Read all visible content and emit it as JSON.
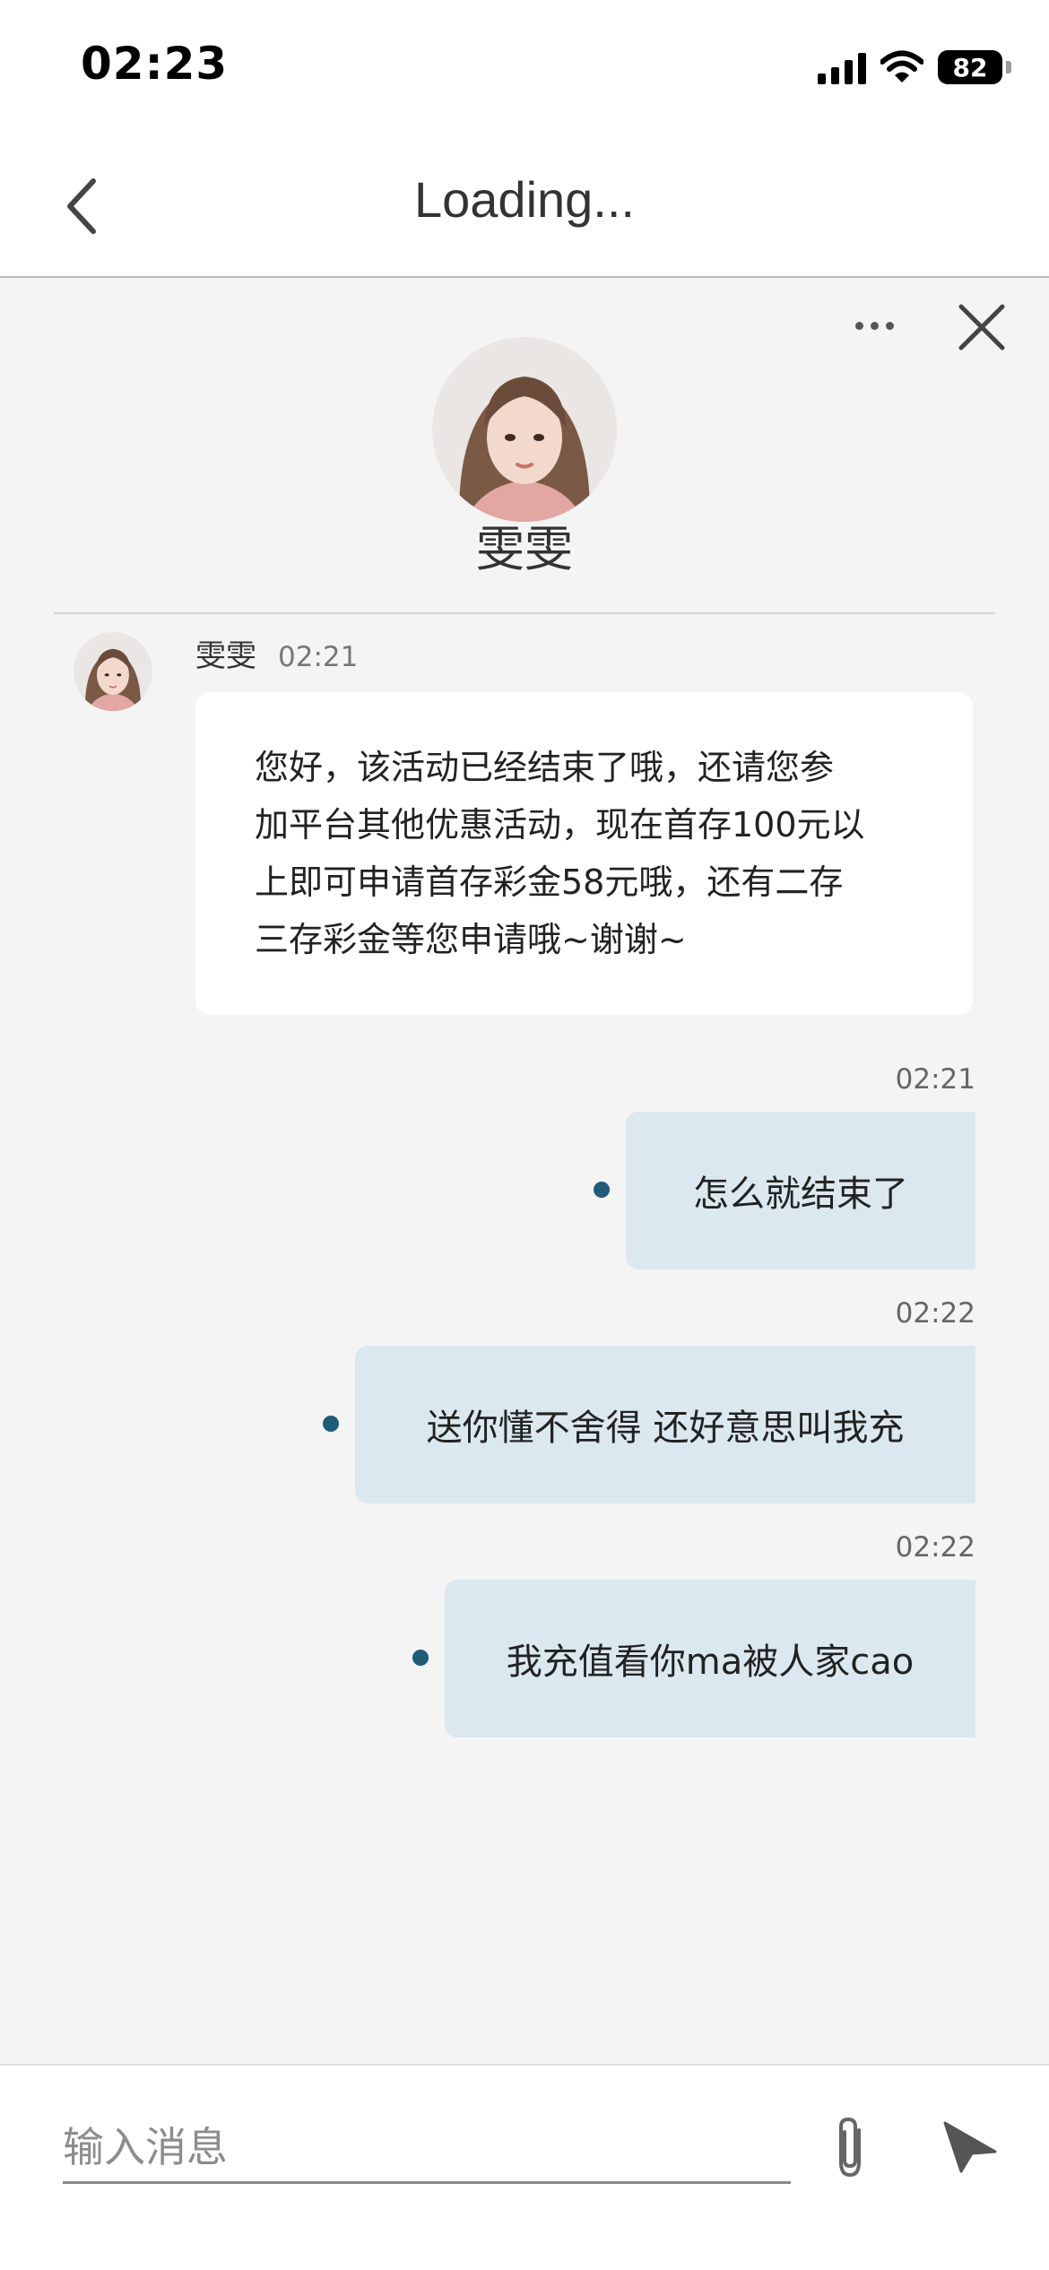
{
  "status_bar": {
    "time": "02:23",
    "battery": "82"
  },
  "nav": {
    "title": "Loading..."
  },
  "agent": {
    "name": "雯雯"
  },
  "messages": {
    "agent_1": {
      "sender": "雯雯",
      "time": "02:21",
      "lines": [
        "您好，该活动已经结束了哦，还请您参",
        "加平台其他优惠活动，现在首存100元以",
        "上即可申请首存彩金58元哦，还有二存",
        "三存彩金等您申请哦~谢谢~"
      ]
    },
    "user_1": {
      "time": "02:21",
      "text": "怎么就结束了"
    },
    "user_2": {
      "time": "02:22",
      "text": "送你懂不舍得 还好意思叫我充"
    },
    "user_3": {
      "time": "02:22",
      "text": "我充值看你ma被人家cao"
    }
  },
  "input": {
    "placeholder": "输入消息",
    "value": ""
  },
  "colors": {
    "user_bubble": "#dbe8f0",
    "status_dot": "#1e5c7a",
    "background": "#f4f4f4"
  }
}
